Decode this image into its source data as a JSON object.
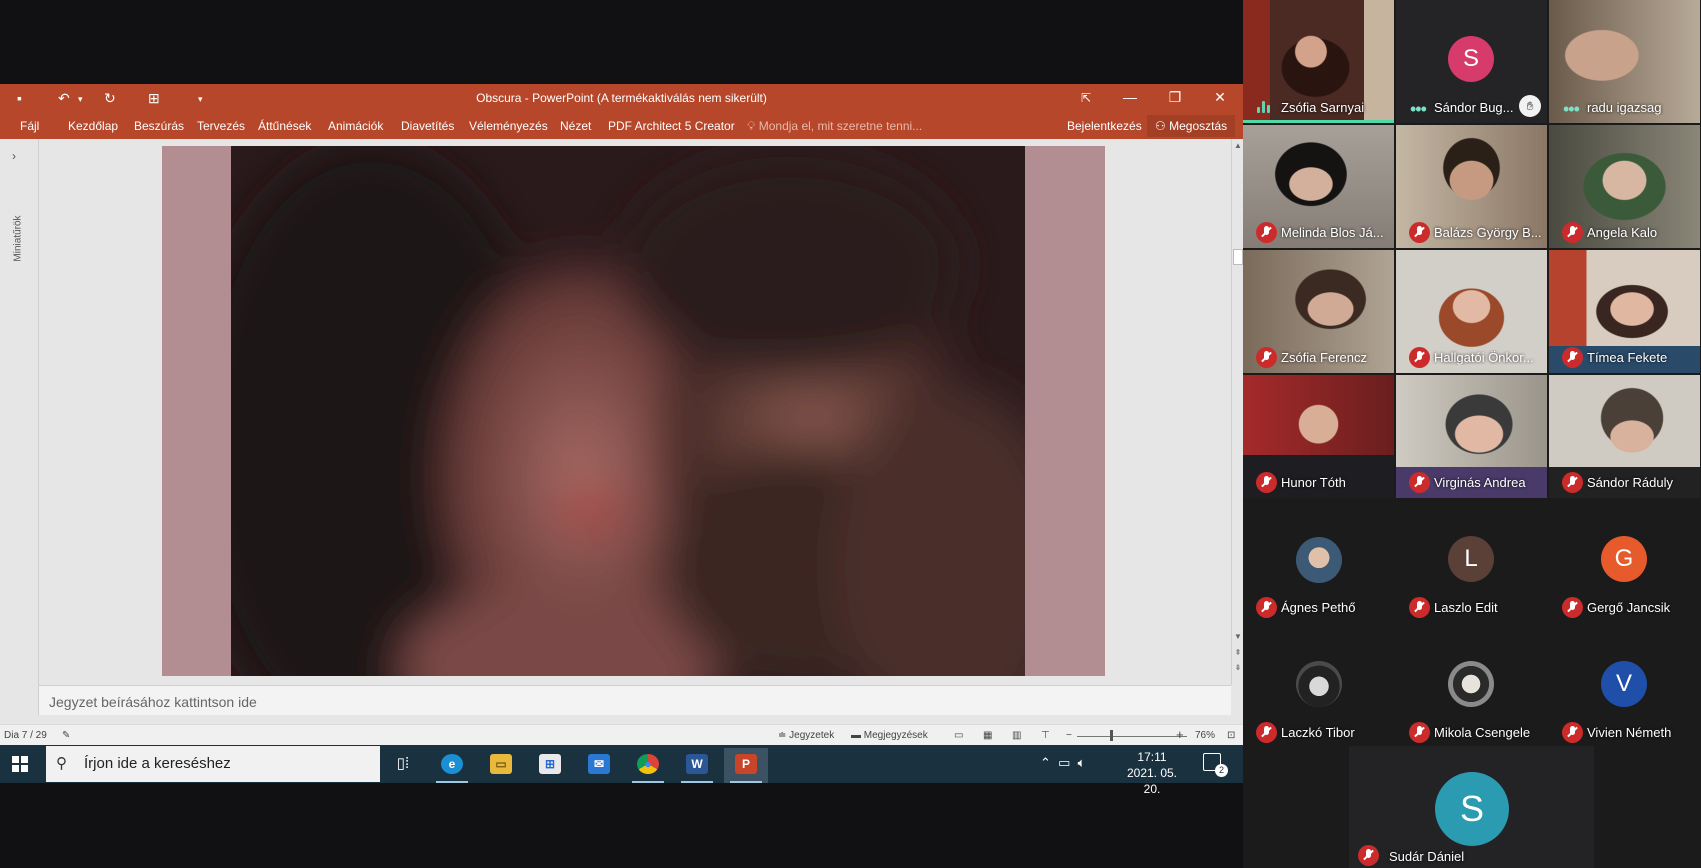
{
  "powerpoint": {
    "title": "Obscura - PowerPoint (A termékaktiválás nem sikerült)",
    "tabs": [
      "Fájl",
      "Kezdőlap",
      "Beszúrás",
      "Tervezés",
      "Áttűnések",
      "Animációk",
      "Diavetítés",
      "Véleményezés",
      "Nézet",
      "PDF Architect 5 Creator"
    ],
    "tell_me": "Mondja el, mit szeretne tenni...",
    "sign_in": "Bejelentkezés",
    "share": "Megosztás",
    "thumbnails_label": "Miniatűrök",
    "notes_placeholder": "Jegyzet beírásához kattintson ide",
    "status": {
      "slide": "Dia 7 / 29",
      "notes": "Jegyzetek",
      "comments": "Megjegyzések",
      "zoom": "76%"
    }
  },
  "taskbar": {
    "search_placeholder": "Írjon ide a kereséshez",
    "time": "17:11",
    "date": "2021. 05. 20.",
    "notification_count": "2",
    "apps": [
      "task-view",
      "edge",
      "file-explorer",
      "store",
      "mail",
      "chrome",
      "word",
      "powerpoint"
    ]
  },
  "participants": [
    {
      "name": "Zsófia Sarnyai",
      "status": "speaking",
      "avatar": "video",
      "bg": "#7a3a2a"
    },
    {
      "name": "Sándor Bug...",
      "status": "active",
      "avatar": "letter",
      "letter": "S",
      "color": "#d63b6b",
      "raised_hand": true
    },
    {
      "name": "radu igazsag",
      "status": "active",
      "avatar": "video",
      "bg": "#8a7e72"
    },
    {
      "name": "Melinda Blos Já...",
      "status": "muted",
      "avatar": "video",
      "bg": "#9a938c"
    },
    {
      "name": "Balázs György B...",
      "status": "muted",
      "avatar": "video",
      "bg": "#8b7564"
    },
    {
      "name": "Angela Kalo",
      "status": "muted",
      "avatar": "video",
      "bg": "#6e6a5e"
    },
    {
      "name": "Zsófia Ferencz",
      "status": "muted",
      "avatar": "video",
      "bg": "#8e8274"
    },
    {
      "name": "Hallgatói Önkor...",
      "status": "muted",
      "avatar": "video",
      "bg": "#c9c5c1"
    },
    {
      "name": "Tímea Fekete",
      "status": "muted",
      "avatar": "video",
      "bg": "#b9a79a"
    },
    {
      "name": "Hunor Tóth",
      "status": "muted",
      "avatar": "video",
      "bg": "#8c2a2a"
    },
    {
      "name": "Virginás Andrea",
      "status": "muted",
      "avatar": "video",
      "bg": "#a8a398"
    },
    {
      "name": "Sándor Ráduly",
      "status": "muted",
      "avatar": "video",
      "bg": "#c7c2b8"
    },
    {
      "name": "Ágnes Pethő",
      "status": "muted",
      "avatar": "photo",
      "bg": "#3c5a76"
    },
    {
      "name": "Laszlo Edit",
      "status": "muted",
      "avatar": "letter",
      "letter": "L",
      "color": "#5a4037"
    },
    {
      "name": "Gergő Jancsik",
      "status": "muted",
      "avatar": "letter",
      "letter": "G",
      "color": "#e65a2b"
    },
    {
      "name": "Laczkó Tibor",
      "status": "muted",
      "avatar": "photo",
      "bg": "#4a4a4a"
    },
    {
      "name": "Mikola Csengele",
      "status": "muted",
      "avatar": "photo",
      "bg": "#6c6c6c"
    },
    {
      "name": "Vivien Németh",
      "status": "muted",
      "avatar": "letter",
      "letter": "V",
      "color": "#1f4fa8"
    },
    {
      "name": "Sudár Dániel",
      "status": "muted",
      "avatar": "letter",
      "letter": "S",
      "color": "#2a9bb0"
    }
  ],
  "colors": {
    "ppt_accent": "#b7472a",
    "taskbar": "#1a3240",
    "gallery_bg": "#1b1b1c",
    "muted_red": "#cc2b2b",
    "speaking_green": "#4fd8a8"
  }
}
